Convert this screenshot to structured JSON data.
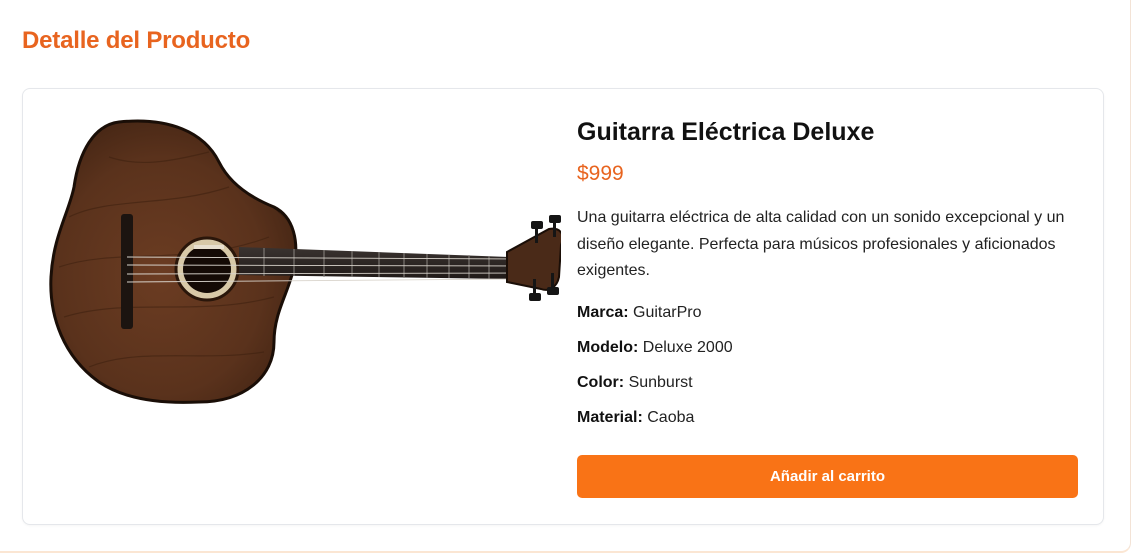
{
  "page": {
    "title": "Detalle del Producto"
  },
  "product": {
    "name": "Guitarra Eléctrica Deluxe",
    "price": "$999",
    "description": "Una guitarra eléctrica de alta calidad con un sonido excepcional y un diseño elegante. Perfecta para músicos profesionales y aficionados exigentes.",
    "image_alt": "Guitarra Eléctrica Deluxe",
    "specs": [
      {
        "label": "Marca:",
        "value": "GuitarPro"
      },
      {
        "label": "Modelo:",
        "value": "Deluxe 2000"
      },
      {
        "label": "Color:",
        "value": "Sunburst"
      },
      {
        "label": "Material:",
        "value": "Caoba"
      }
    ]
  },
  "actions": {
    "add_to_cart_label": "Añadir al carrito"
  },
  "colors": {
    "accent": "#e8641f",
    "button": "#f97316",
    "guitar_wood": "#5a321c"
  }
}
